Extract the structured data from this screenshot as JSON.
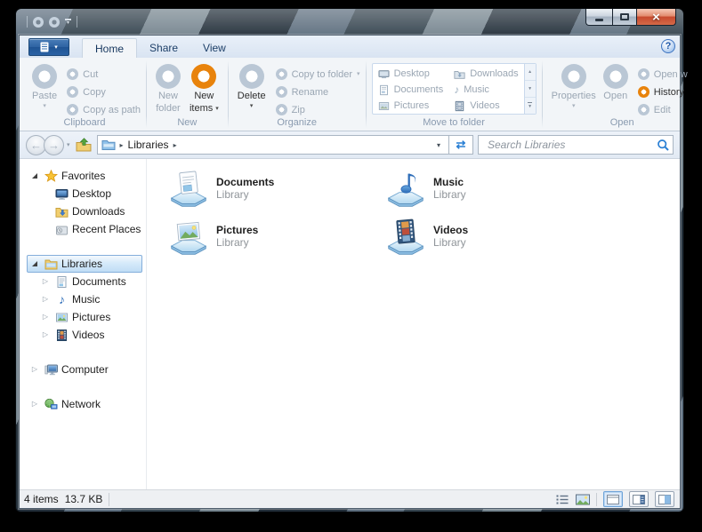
{
  "icons": {
    "caret_down": "▾",
    "breadcrumb_arrow": "▸",
    "collapsed_arrow": "▷",
    "overflow_arrow": "▸",
    "refresh": "⇄",
    "help": "?",
    "close": "×",
    "back": "←",
    "forward": "→",
    "scroll_up": "▲",
    "scroll_down": "▼",
    "music_note": "♪"
  },
  "tabs": {
    "home": "Home",
    "share": "Share",
    "view": "View"
  },
  "ribbon": {
    "clipboard": {
      "group": "Clipboard",
      "paste": "Paste",
      "cut": "Cut",
      "copy": "Copy",
      "copy_as_path": "Copy as path"
    },
    "new": {
      "group": "New",
      "new_folder_1": "New",
      "new_folder_2": "folder",
      "new_items_1": "New",
      "new_items_2": "items"
    },
    "organize": {
      "group": "Organize",
      "delete": "Delete",
      "copy_to_folder": "Copy to folder",
      "rename": "Rename",
      "zip": "Zip"
    },
    "move": {
      "group": "Move to folder",
      "col1": [
        "Desktop",
        "Documents",
        "Pictures"
      ],
      "col2": [
        "Downloads",
        "Music",
        "Videos"
      ]
    },
    "open": {
      "group": "Open",
      "properties": "Properties",
      "open": "Open",
      "open_with": "Open w",
      "history": "History",
      "edit": "Edit"
    }
  },
  "navbar": {
    "breadcrumb_root": "Libraries",
    "search_placeholder": "Search Libraries"
  },
  "sidebar": {
    "favorites": "Favorites",
    "desktop": "Desktop",
    "downloads": "Downloads",
    "recent": "Recent Places",
    "libraries": "Libraries",
    "documents": "Documents",
    "music": "Music",
    "pictures": "Pictures",
    "videos": "Videos",
    "computer": "Computer",
    "network": "Network"
  },
  "tiles": [
    {
      "name": "Documents",
      "type": "Library"
    },
    {
      "name": "Music",
      "type": "Library"
    },
    {
      "name": "Pictures",
      "type": "Library"
    },
    {
      "name": "Videos",
      "type": "Library"
    }
  ],
  "statusbar": {
    "count": "4 items",
    "size": "13.7 KB"
  },
  "colors": {
    "accent_orange": "#e8830c",
    "donut_ring": "#bac7d5",
    "selection_border": "#84aedb",
    "close_red": "#c74a2e"
  }
}
